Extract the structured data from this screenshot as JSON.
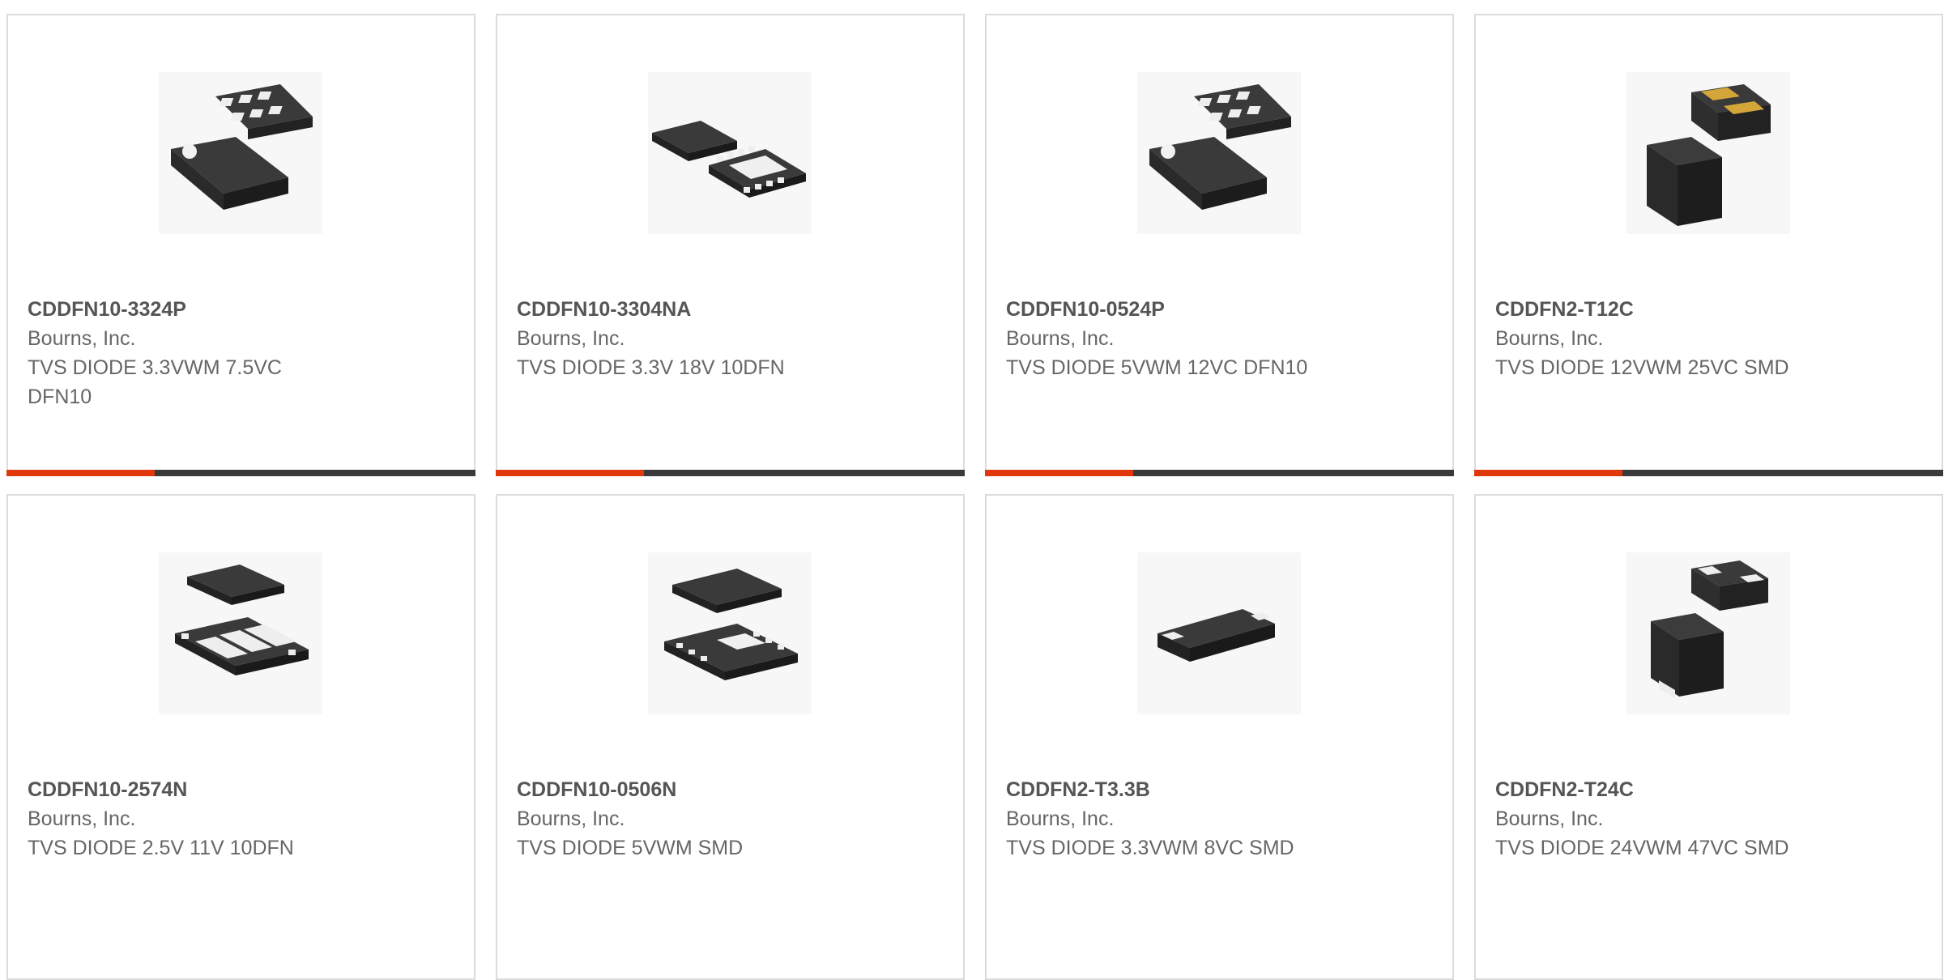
{
  "accent_color": "#e0380b",
  "bar_color": "#3a3a3a",
  "products": [
    {
      "part": "CDDFN10-3324P",
      "manufacturer": "Bourns, Inc.",
      "description": "TVS DIODE 3.3VWM 7.5VC DFN10",
      "icon": "dfn10-tvs-diode-package"
    },
    {
      "part": "CDDFN10-3304NA",
      "manufacturer": "Bourns, Inc.",
      "description": "TVS DIODE 3.3V 18V 10DFN",
      "icon": "dfn10-tvs-diode-package"
    },
    {
      "part": "CDDFN10-0524P",
      "manufacturer": "Bourns, Inc.",
      "description": "TVS DIODE 5VWM 12VC DFN10",
      "icon": "dfn10-tvs-diode-package"
    },
    {
      "part": "CDDFN2-T12C",
      "manufacturer": "Bourns, Inc.",
      "description": "TVS DIODE 12VWM 25VC SMD",
      "icon": "dfn2-tvs-diode-package"
    },
    {
      "part": "CDDFN10-2574N",
      "manufacturer": "Bourns, Inc.",
      "description": "TVS DIODE 2.5V 11V 10DFN",
      "icon": "dfn10-tvs-diode-package"
    },
    {
      "part": "CDDFN10-0506N",
      "manufacturer": "Bourns, Inc.",
      "description": "TVS DIODE 5VWM SMD",
      "icon": "dfn10-tvs-diode-package"
    },
    {
      "part": "CDDFN2-T3.3B",
      "manufacturer": "Bourns, Inc.",
      "description": "TVS DIODE 3.3VWM 8VC SMD",
      "icon": "dfn2-tvs-diode-package"
    },
    {
      "part": "CDDFN2-T24C",
      "manufacturer": "Bourns, Inc.",
      "description": "TVS DIODE 24VWM 47VC SMD",
      "icon": "dfn2-tvs-diode-package"
    }
  ]
}
